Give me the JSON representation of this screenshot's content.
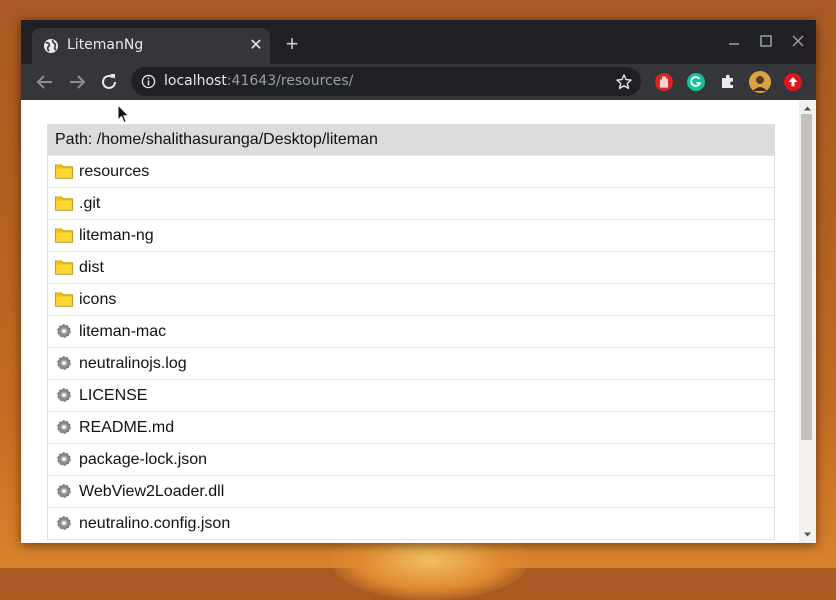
{
  "tab": {
    "title": "LitemanNg",
    "close_glyph": "✕",
    "new_tab_glyph": "+",
    "icon": "globe-icon"
  },
  "window_controls": [
    "minimize-icon",
    "maximize-icon",
    "close-icon"
  ],
  "toolbar": {
    "url_host": "localhost",
    "url_rest": ":41643/resources/",
    "info_icon": "info-icon",
    "bookmark_icon": "star-icon",
    "extensions": [
      "hand-extension-icon",
      "grammarly-icon",
      "puzzle-extensions-icon",
      "profile-avatar",
      "update-icon"
    ]
  },
  "listing": {
    "path_label": "Path: /home/shalithasuranga/Desktop/liteman",
    "entries": [
      {
        "name": "resources",
        "type": "folder"
      },
      {
        "name": ".git",
        "type": "folder"
      },
      {
        "name": "liteman-ng",
        "type": "folder"
      },
      {
        "name": "dist",
        "type": "folder"
      },
      {
        "name": "icons",
        "type": "folder"
      },
      {
        "name": "liteman-mac",
        "type": "file"
      },
      {
        "name": "neutralinojs.log",
        "type": "file"
      },
      {
        "name": "LICENSE",
        "type": "file"
      },
      {
        "name": "README.md",
        "type": "file"
      },
      {
        "name": "package-lock.json",
        "type": "file"
      },
      {
        "name": "WebView2Loader.dll",
        "type": "file"
      },
      {
        "name": "neutralino.config.json",
        "type": "file"
      }
    ]
  },
  "colors": {
    "folder": "#f3c200",
    "gear": "#8a8a8a",
    "path_bg": "#dcdcdc",
    "titlebar": "#202124",
    "toolbar": "#35363a"
  }
}
